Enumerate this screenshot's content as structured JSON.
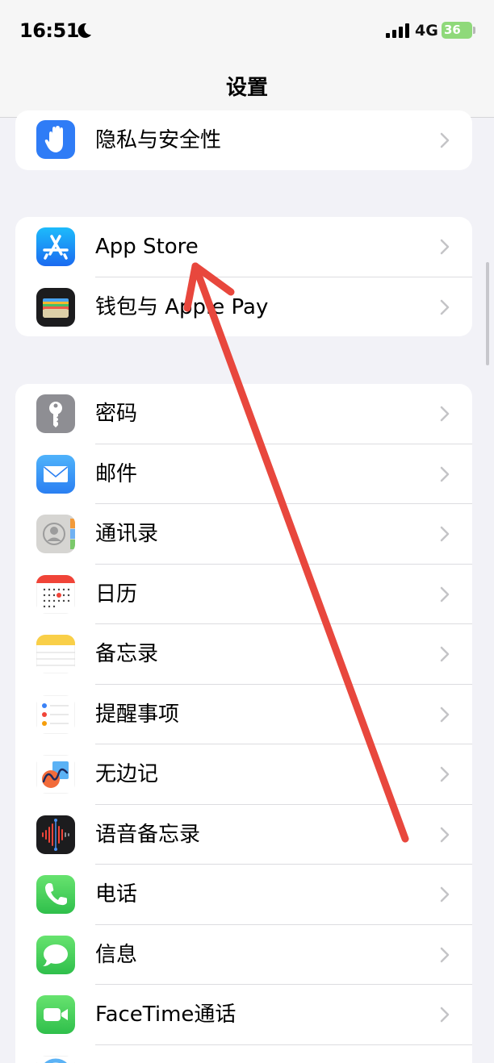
{
  "status": {
    "time": "16:51",
    "network": "4G",
    "battery": "36"
  },
  "nav": {
    "title": "设置"
  },
  "groups": [
    {
      "items": [
        {
          "label": "隐私与安全性",
          "icon": "hand-icon"
        }
      ]
    },
    {
      "items": [
        {
          "label": "App Store",
          "icon": "app-store-icon"
        },
        {
          "label": "钱包与 Apple Pay",
          "icon": "wallet-icon"
        }
      ]
    },
    {
      "items": [
        {
          "label": "密码",
          "icon": "key-icon"
        },
        {
          "label": "邮件",
          "icon": "mail-icon"
        },
        {
          "label": "通讯录",
          "icon": "contacts-icon"
        },
        {
          "label": "日历",
          "icon": "calendar-icon"
        },
        {
          "label": "备忘录",
          "icon": "notes-icon"
        },
        {
          "label": "提醒事项",
          "icon": "reminders-icon"
        },
        {
          "label": "无边记",
          "icon": "freeform-icon"
        },
        {
          "label": "语音备忘录",
          "icon": "voice-memos-icon"
        },
        {
          "label": "电话",
          "icon": "phone-icon"
        },
        {
          "label": "信息",
          "icon": "messages-icon"
        },
        {
          "label": "FaceTime通话",
          "icon": "facetime-icon"
        }
      ]
    }
  ],
  "colors": {
    "background": "#f2f2f7",
    "annotation_arrow": "#e8473d",
    "privacy": "#2f7cf6",
    "app_store": "#1e8ef9",
    "mail": "#3a9bf7",
    "phone": "#3fcb5a",
    "voice_memos": "#1c1c1e"
  }
}
